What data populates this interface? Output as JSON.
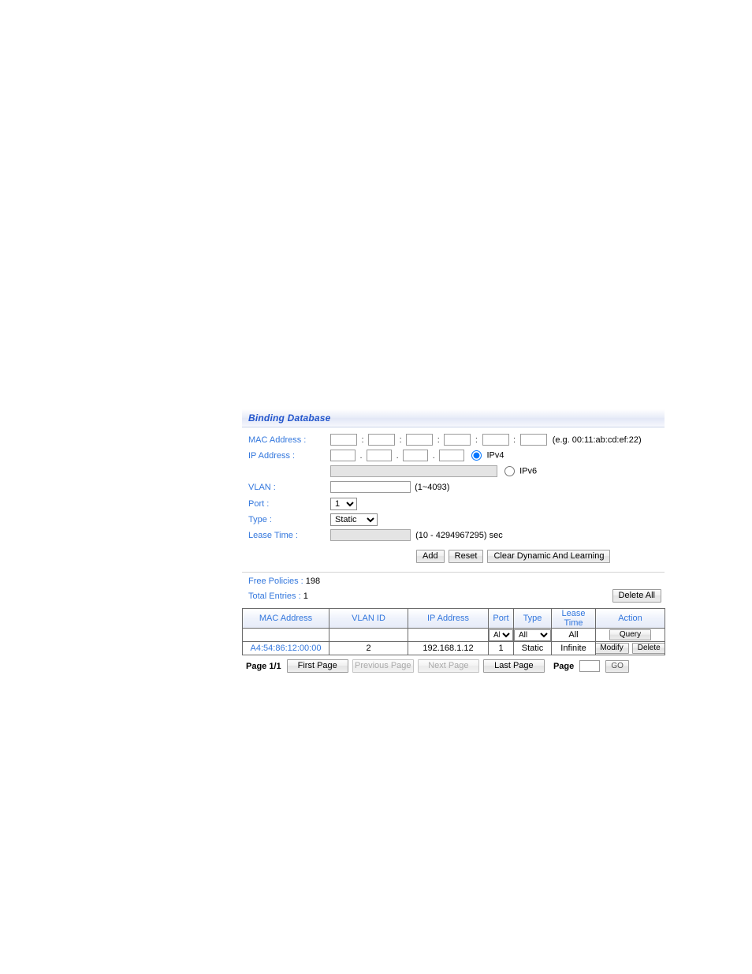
{
  "panel": {
    "title": "Binding Database"
  },
  "form": {
    "mac": {
      "label": "MAC Address :",
      "separator": ":",
      "values": [
        "",
        "",
        "",
        "",
        "",
        ""
      ],
      "hint": "(e.g. 00:11:ab:cd:ef:22)"
    },
    "ip": {
      "label": "IP Address :",
      "separator": ".",
      "values": [
        "",
        "",
        "",
        ""
      ],
      "ipv4_label": "IPv4",
      "ipv4_selected": true,
      "ipv6_label": "IPv6",
      "ipv6_selected": false,
      "ipv6_value": ""
    },
    "vlan": {
      "label": "VLAN :",
      "value": "",
      "hint": "(1~4093)"
    },
    "port": {
      "label": "Port :",
      "value": "1",
      "options": [
        "1"
      ]
    },
    "type": {
      "label": "Type :",
      "value": "Static",
      "options": [
        "Static"
      ]
    },
    "lease_time": {
      "label": "Lease Time :",
      "value": "",
      "hint": "(10 - 4294967295) sec"
    },
    "buttons": {
      "add": "Add",
      "reset": "Reset",
      "clear": "Clear Dynamic And Learning"
    }
  },
  "summary": {
    "free_policies_label": "Free Policies :",
    "free_policies_value": "198",
    "total_entries_label": "Total Entries :",
    "total_entries_value": "1",
    "delete_all": "Delete All"
  },
  "table": {
    "headers": [
      "MAC Address",
      "VLAN ID",
      "IP Address",
      "Port",
      "Type",
      "Lease Time",
      "Action"
    ],
    "query_row": {
      "mac": "",
      "vlan": "",
      "ip": "",
      "port": "All",
      "port_options": [
        "All"
      ],
      "type": "All",
      "type_options": [
        "All"
      ],
      "lease_time": "All",
      "query_button": "Query"
    },
    "rows": [
      {
        "mac": "A4:54:86:12:00:00",
        "vlan": "2",
        "ip": "192.168.1.12",
        "port": "1",
        "type": "Static",
        "lease_time": "Infinite",
        "modify": "Modify",
        "delete": "Delete"
      }
    ]
  },
  "pagination": {
    "page_indicator": "Page 1/1",
    "first_page": "First Page",
    "previous_page": "Previous Page",
    "next_page": "Next Page",
    "last_page": "Last Page",
    "page_label": "Page",
    "page_value": "",
    "go": "GO"
  }
}
